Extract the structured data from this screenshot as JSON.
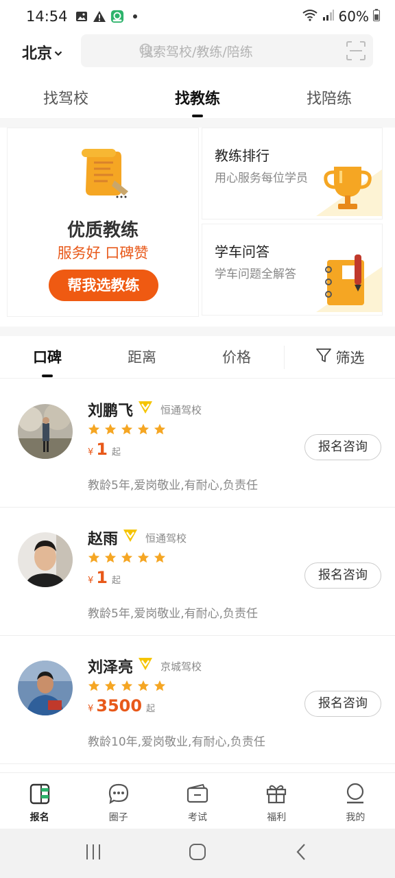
{
  "status_bar": {
    "time": "14:54",
    "battery": "60%"
  },
  "header": {
    "city": "北京",
    "search_placeholder": "搜索驾校/教练/陪练"
  },
  "top_tabs": [
    {
      "label": "找驾校"
    },
    {
      "label": "找教练"
    },
    {
      "label": "找陪练"
    }
  ],
  "promo": {
    "main": {
      "title": "优质教练",
      "subtitle": "服务好 口碑赞",
      "button": "帮我选教练"
    },
    "ranking": {
      "title": "教练排行",
      "subtitle": "用心服务每位学员"
    },
    "qa": {
      "title": "学车问答",
      "subtitle": "学车问题全解答"
    }
  },
  "sort_tabs": [
    {
      "label": "口碑"
    },
    {
      "label": "距离"
    },
    {
      "label": "价格"
    }
  ],
  "filter_label": "筛选",
  "coaches": [
    {
      "name": "刘鹏飞",
      "school": "恒通驾校",
      "rating": 5,
      "price": "1",
      "currency": "¥",
      "unit": "起",
      "desc": "教龄5年,爱岗敬业,有耐心,负责任",
      "button": "报名咨询"
    },
    {
      "name": "赵雨",
      "school": "恒通驾校",
      "rating": 5,
      "price": "1",
      "currency": "¥",
      "unit": "起",
      "desc": "教龄5年,爱岗敬业,有耐心,负责任",
      "button": "报名咨询"
    },
    {
      "name": "刘泽亮",
      "school": "京城驾校",
      "rating": 5,
      "price": "3500",
      "currency": "¥",
      "unit": "起",
      "desc": "教龄10年,爱岗敬业,有耐心,负责任",
      "button": "报名咨询"
    }
  ],
  "bottom_nav": [
    {
      "label": "报名",
      "icon": "signup-icon"
    },
    {
      "label": "圈子",
      "icon": "chat-icon"
    },
    {
      "label": "考试",
      "icon": "exam-icon"
    },
    {
      "label": "福利",
      "icon": "gift-icon"
    },
    {
      "label": "我的",
      "icon": "profile-icon"
    }
  ],
  "colors": {
    "accent": "#ef5a12",
    "star": "#f5a623",
    "badge": "#f5c400"
  }
}
